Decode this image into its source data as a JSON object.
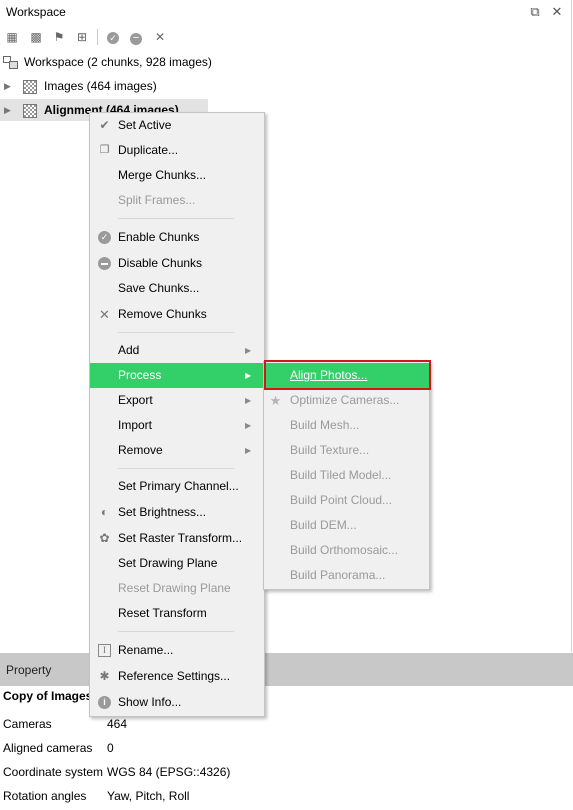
{
  "window": {
    "title": "Workspace"
  },
  "toolbar": {
    "icons": [
      "add-chunk-icon",
      "add-photos-icon",
      "add-marker-icon",
      "add-folder-icon",
      "check-icon",
      "minus-icon",
      "close-icon"
    ]
  },
  "tree": {
    "workspace": "Workspace (2 chunks, 928 images)",
    "chunk1": "Images (464 images)",
    "chunk2": "Alignment (464 images)"
  },
  "context_menu": {
    "set_active": "Set Active",
    "duplicate": "Duplicate...",
    "merge_chunks": "Merge Chunks...",
    "split_frames": "Split Frames...",
    "enable_chunks": "Enable Chunks",
    "disable_chunks": "Disable Chunks",
    "save_chunks": "Save Chunks...",
    "remove_chunks": "Remove Chunks",
    "add": "Add",
    "process": "Process",
    "export": "Export",
    "import": "Import",
    "remove": "Remove",
    "set_primary_channel": "Set Primary Channel...",
    "set_brightness": "Set Brightness...",
    "set_raster_transform": "Set Raster Transform...",
    "set_drawing_plane": "Set Drawing Plane",
    "reset_drawing_plane": "Reset Drawing Plane",
    "reset_transform": "Reset Transform",
    "rename": "Rename...",
    "reference_settings": "Reference Settings...",
    "show_info": "Show Info..."
  },
  "process_submenu": {
    "align_photos": "Align Photos...",
    "optimize_cameras": "Optimize Cameras...",
    "build_mesh": "Build Mesh...",
    "build_texture": "Build Texture...",
    "build_tiled_model": "Build Tiled Model...",
    "build_point_cloud": "Build Point Cloud...",
    "build_dem": "Build DEM...",
    "build_orthomosaic": "Build Orthomosaic...",
    "build_panorama": "Build Panorama..."
  },
  "property_panel": {
    "header": "Property",
    "title": "Copy of Images",
    "rows": [
      {
        "key": "Cameras",
        "value": "464"
      },
      {
        "key": "Aligned cameras",
        "value": "0"
      },
      {
        "key": "Coordinate system",
        "value": "WGS 84 (EPSG::4326)"
      },
      {
        "key": "Rotation angles",
        "value": "Yaw, Pitch, Roll"
      }
    ]
  },
  "colors": {
    "highlight": "#33d06a",
    "focus_box": "#d11717",
    "menu_bg": "#f0f0f0",
    "panel_header": "#c8c8c8"
  }
}
